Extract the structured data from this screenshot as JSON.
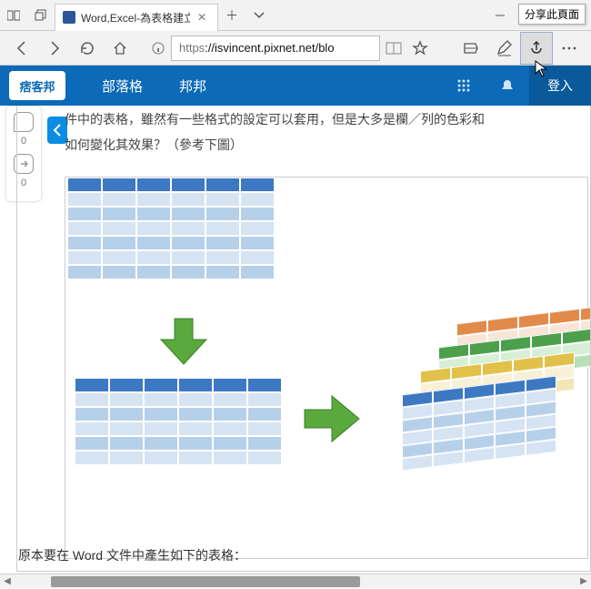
{
  "window": {
    "tab_title": "Word,Excel-為表格建立|",
    "tooltip_share": "分享此頁面"
  },
  "address": {
    "scheme": "https",
    "path": "://isvincent.pixnet.net/blo"
  },
  "sitebar": {
    "logo": "痞客邦",
    "nav1": "部落格",
    "nav2": "邦邦",
    "login": "登入"
  },
  "float": {
    "count_comment": "0",
    "count_share": "0"
  },
  "article": {
    "line1": "件中的表格，雖然有一些格式的設定可以套用，但是大多是欄／列的色彩和",
    "line2": "如何變化其效果？（參考下圖）",
    "bottom": "原本要在 Word 文件中產生如下的表格："
  }
}
